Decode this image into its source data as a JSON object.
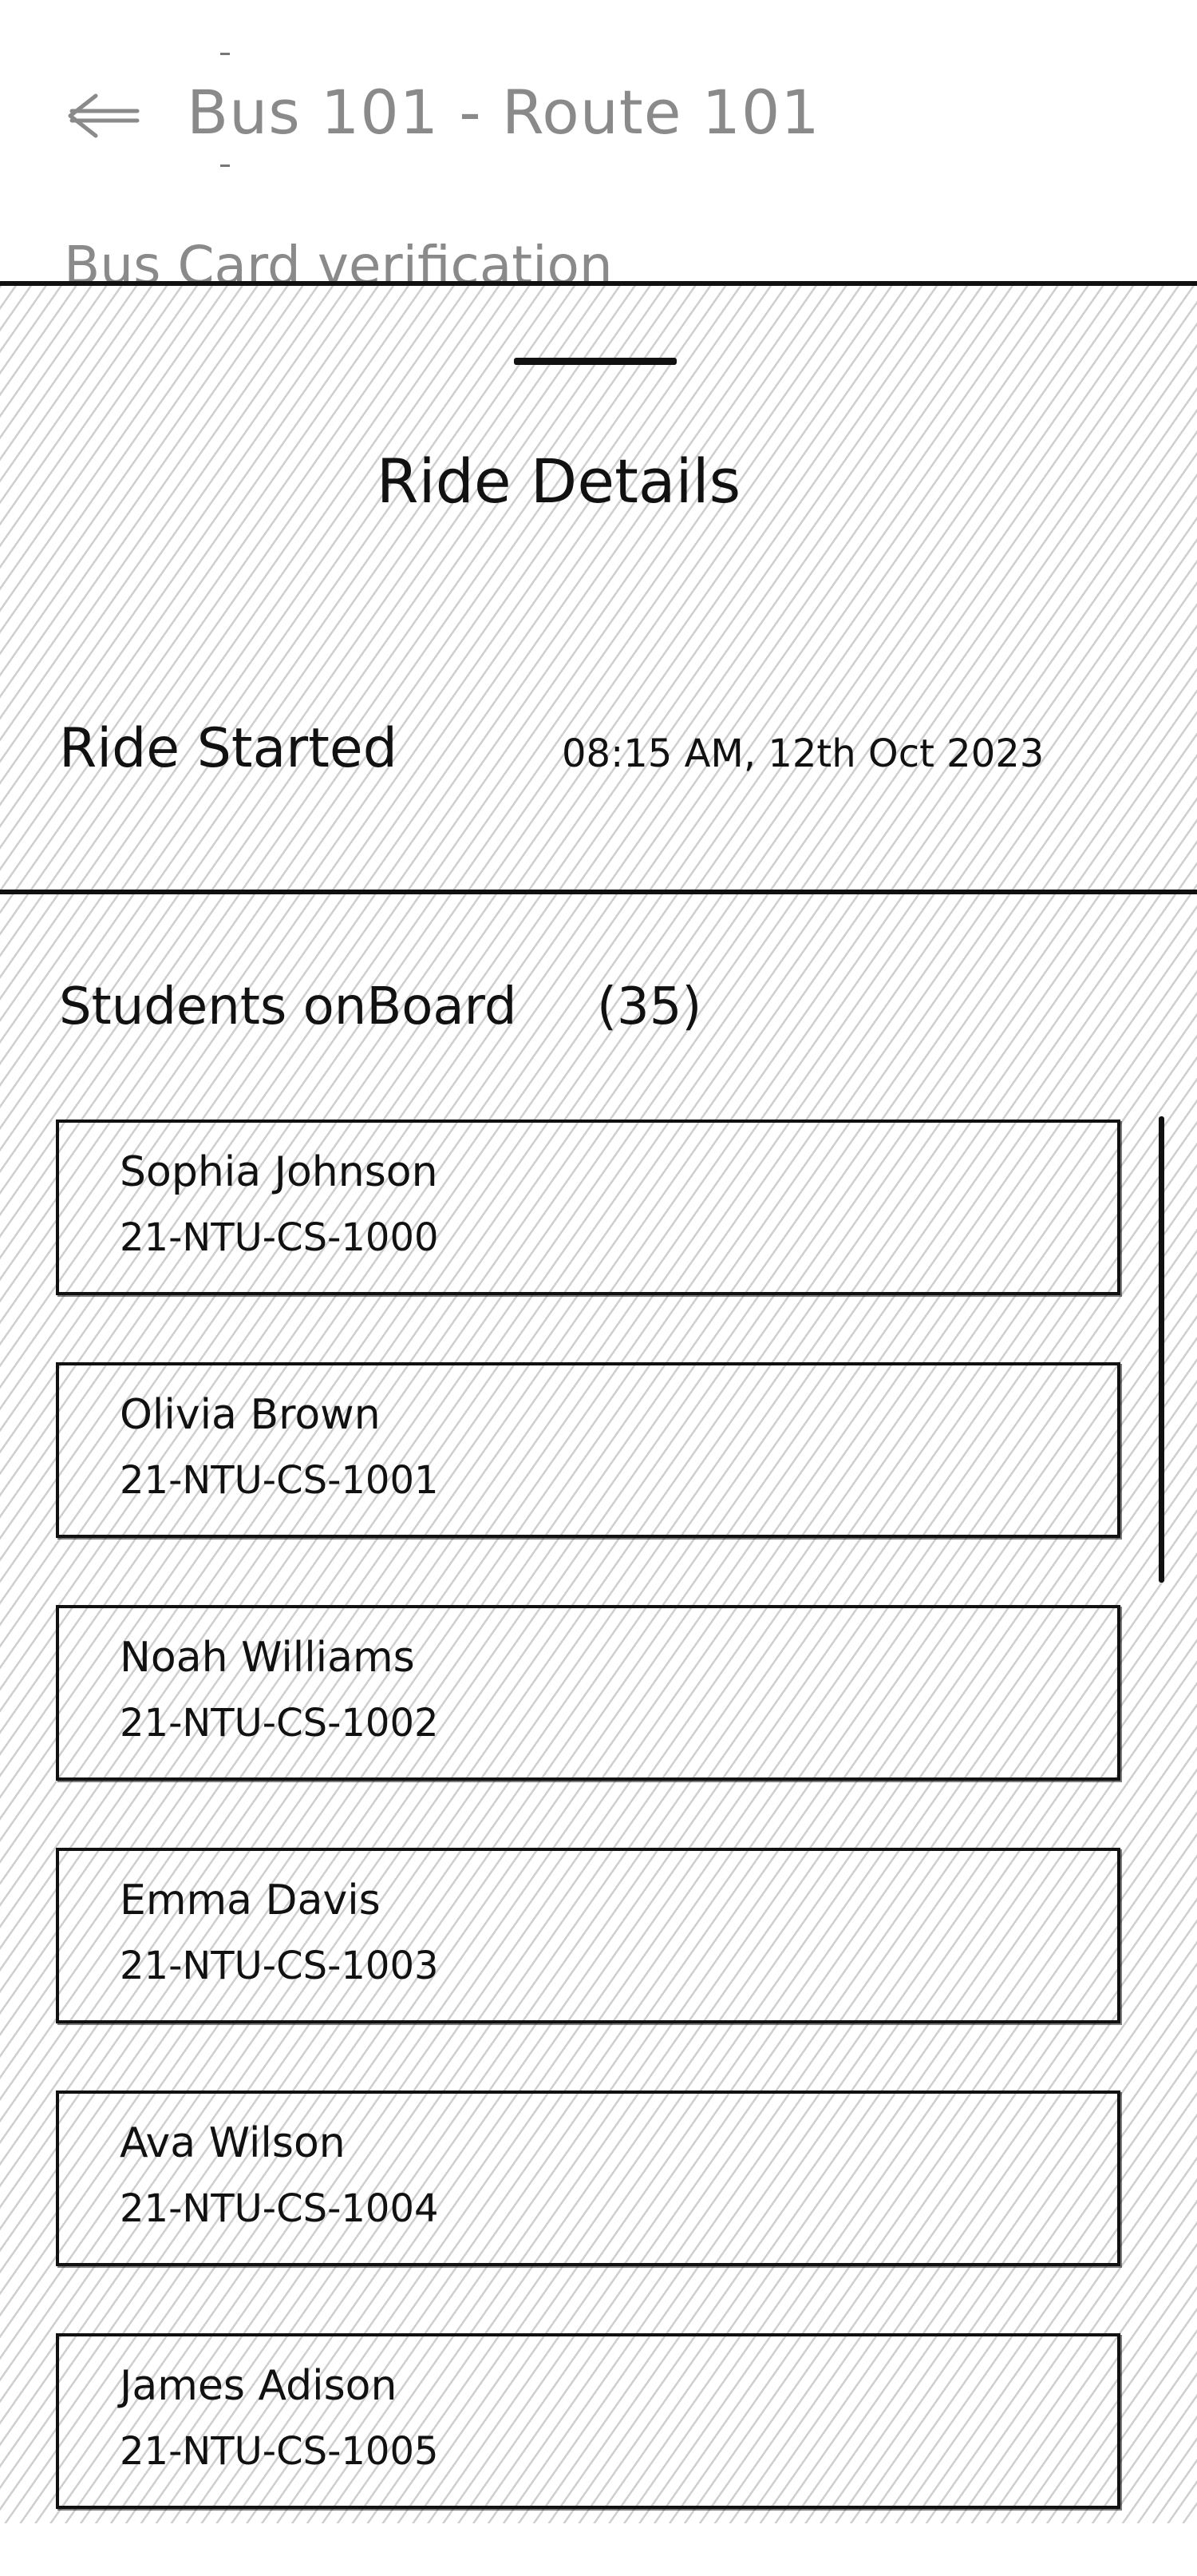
{
  "header": {
    "back_icon": "arrow-left-icon",
    "title": "Bus 101 - Route 101",
    "subtitle": "Bus Card verification"
  },
  "sheet": {
    "title": "Ride Details",
    "ride_started_label": "Ride Started",
    "ride_started_value": "08:15 AM, 12th Oct 2023",
    "students_label": "Students onBoard",
    "students_count": "(35)",
    "students": [
      {
        "name": "Sophia Johnson",
        "id": "21-NTU-CS-1000"
      },
      {
        "name": "Olivia Brown",
        "id": "21-NTU-CS-1001"
      },
      {
        "name": "Noah Williams",
        "id": "21-NTU-CS-1002"
      },
      {
        "name": "Emma Davis",
        "id": "21-NTU-CS-1003"
      },
      {
        "name": "Ava Wilson",
        "id": "21-NTU-CS-1004"
      },
      {
        "name": "James Adison",
        "id": "21-NTU-CS-1005"
      }
    ]
  },
  "colors": {
    "ink": "#111111",
    "muted": "#8a8a8a",
    "hatch": "#cfcfcf",
    "background": "#ffffff"
  }
}
